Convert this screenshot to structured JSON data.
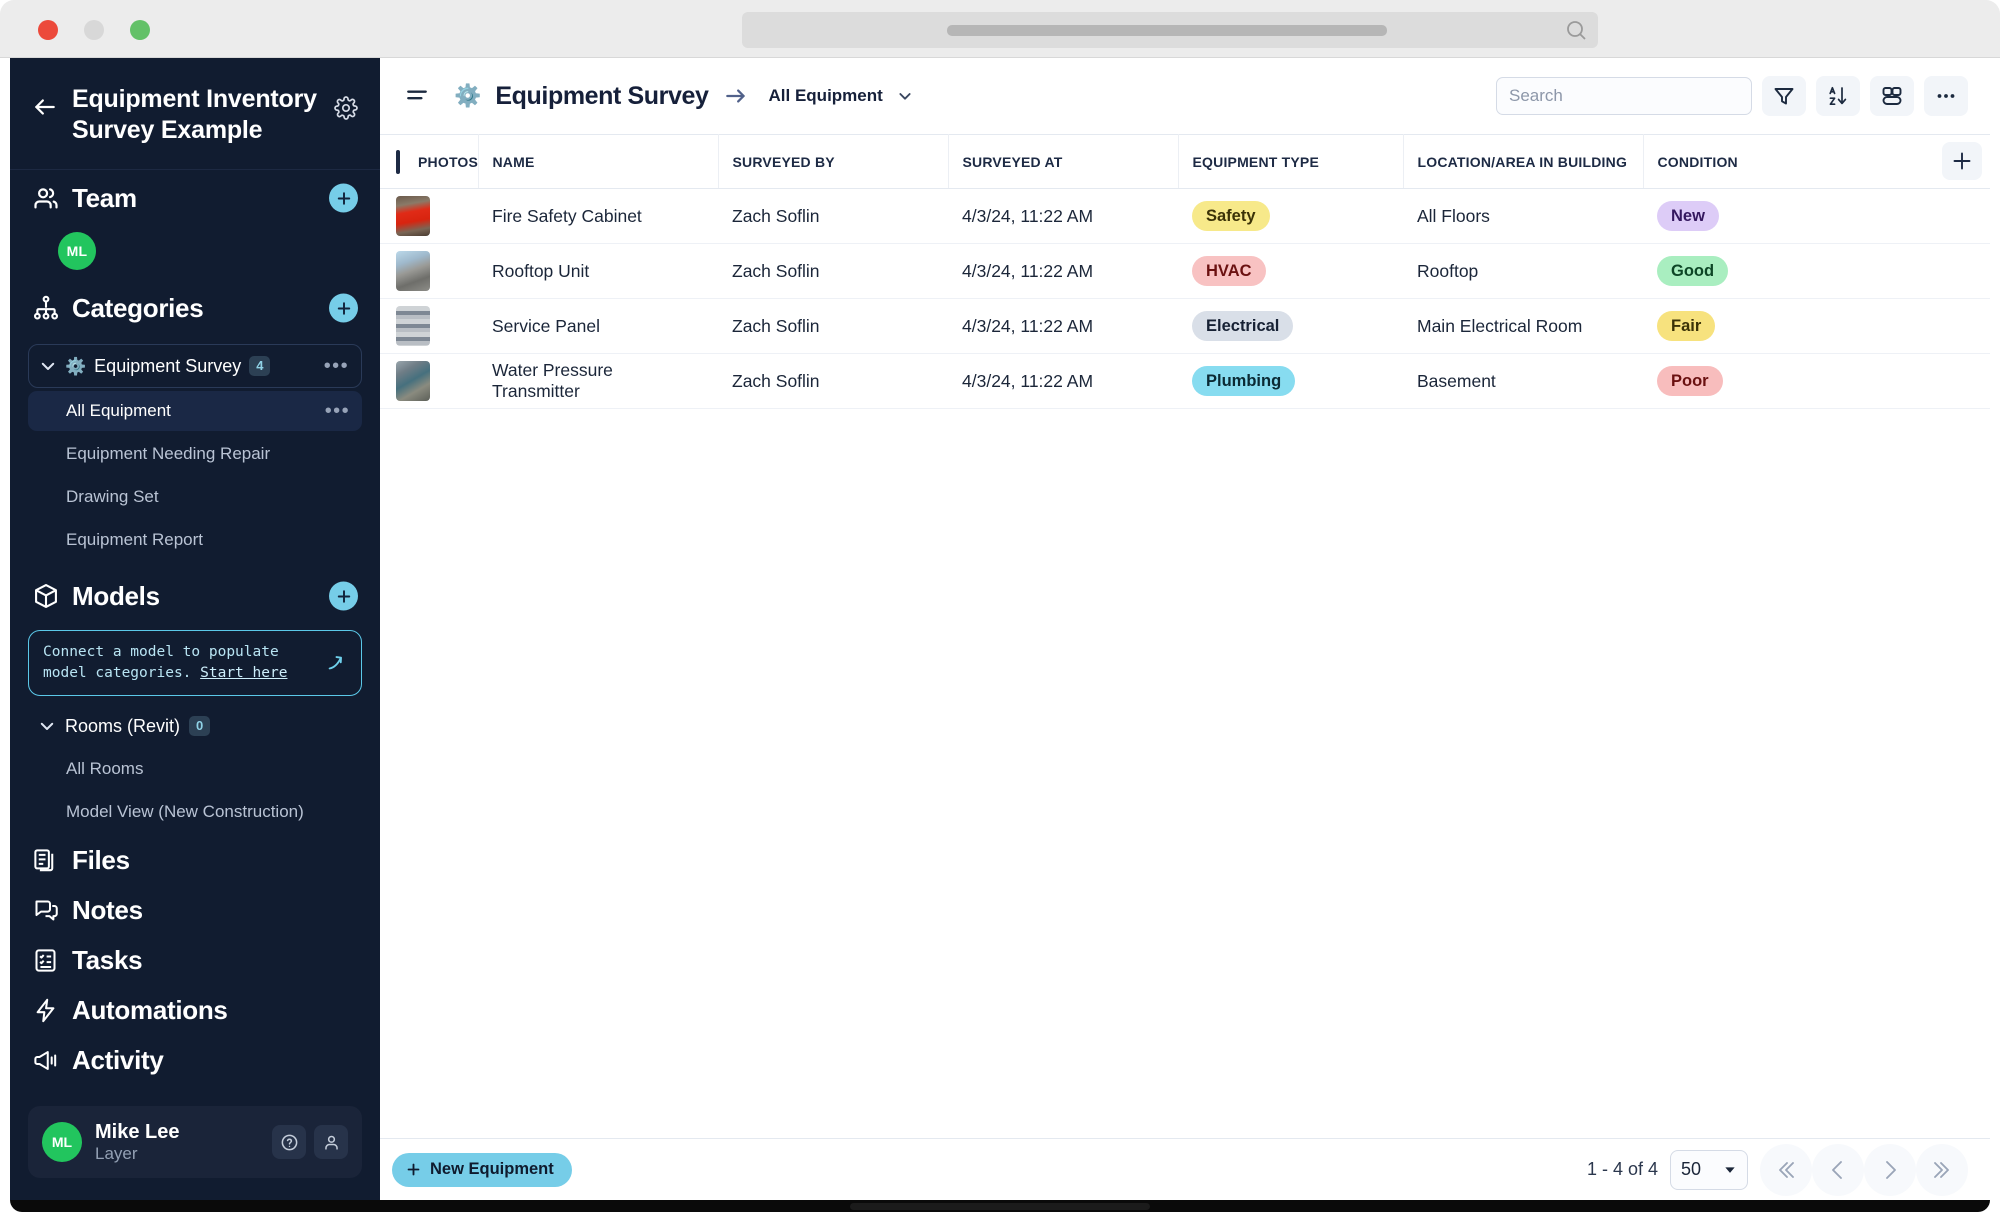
{
  "window": {
    "traffic_lights": [
      "close",
      "minimize",
      "zoom"
    ],
    "url_placeholder": ""
  },
  "sidebar": {
    "project_title": "Equipment Inventory Survey Example",
    "back_icon": "back-arrow-icon",
    "settings_icon": "gear-icon",
    "team": {
      "label": "Team",
      "icon": "people-icon",
      "add_label": "+",
      "members": [
        {
          "initials": "ML"
        }
      ]
    },
    "categories": {
      "label": "Categories",
      "icon": "hierarchy-icon",
      "add_label": "+",
      "groups": [
        {
          "emoji": "⚙️",
          "name": "Equipment Survey",
          "count": "4",
          "items": [
            {
              "label": "All Equipment",
              "active": true
            },
            {
              "label": "Equipment Needing Repair",
              "active": false
            },
            {
              "label": "Drawing Set",
              "active": false
            },
            {
              "label": "Equipment Report",
              "active": false
            }
          ]
        }
      ]
    },
    "models": {
      "label": "Models",
      "icon": "cube-icon",
      "add_label": "+",
      "banner": {
        "text": "Connect a model to populate model categories. ",
        "link": "Start here",
        "icon": "arrow-up-right-icon"
      },
      "groups": [
        {
          "name": "Rooms (Revit)",
          "count": "0",
          "items": [
            {
              "label": "All Rooms",
              "active": false
            },
            {
              "label": "Model View (New Construction)",
              "active": false
            }
          ]
        }
      ]
    },
    "nav": [
      {
        "label": "Files",
        "icon": "files-icon"
      },
      {
        "label": "Notes",
        "icon": "notes-icon"
      },
      {
        "label": "Tasks",
        "icon": "tasks-icon"
      },
      {
        "label": "Automations",
        "icon": "lightning-icon"
      },
      {
        "label": "Activity",
        "icon": "megaphone-icon"
      }
    ],
    "user": {
      "initials": "ML",
      "name": "Mike Lee",
      "org": "Layer",
      "help_icon": "question-circle-icon",
      "account_icon": "person-icon"
    }
  },
  "toolbar": {
    "menu_icon": "hamburger-icon",
    "breadcrumb_emoji": "⚙️",
    "breadcrumb_title": "Equipment Survey",
    "breadcrumb_arrow_icon": "arrow-right-icon",
    "breadcrumb_view": "All Equipment",
    "view_chevron_icon": "chevron-down-icon",
    "search_placeholder": "Search",
    "search_value": "",
    "filter_icon": "filter-icon",
    "sort_icon": "sort-az-icon",
    "group_icon": "group-icon",
    "more_icon": "more-horizontal-icon"
  },
  "table": {
    "select_all_checked": false,
    "add_column_icon": "plus-icon",
    "columns": [
      "PHOTOS",
      "NAME",
      "SURVEYED BY",
      "SURVEYED AT",
      "EQUIPMENT TYPE",
      "LOCATION/AREA IN BUILDING",
      "CONDITION"
    ],
    "rows": [
      {
        "photo_alt": "fire-safety-cabinet-photo",
        "name": "Fire Safety Cabinet",
        "surveyed_by": "Zach Soflin",
        "surveyed_at": "4/3/24, 11:22 AM",
        "equipment_type": "Safety",
        "equipment_type_bg": "#f7e98a",
        "equipment_type_fg": "#3b3207",
        "location": "All Floors",
        "condition": "New",
        "condition_bg": "#ddccf7",
        "condition_fg": "#35185f"
      },
      {
        "photo_alt": "rooftop-unit-photo",
        "name": "Rooftop Unit",
        "surveyed_by": "Zach Soflin",
        "surveyed_at": "4/3/24, 11:22 AM",
        "equipment_type": "HVAC",
        "equipment_type_bg": "#f8c2c2",
        "equipment_type_fg": "#6b1111",
        "location": "Rooftop",
        "condition": "Good",
        "condition_bg": "#a9eec0",
        "condition_fg": "#0d4626"
      },
      {
        "photo_alt": "service-panel-photo",
        "name": "Service Panel",
        "surveyed_by": "Zach Soflin",
        "surveyed_at": "4/3/24, 11:22 AM",
        "equipment_type": "Electrical",
        "equipment_type_bg": "#d9dfe8",
        "equipment_type_fg": "#172134",
        "location": "Main Electrical Room",
        "condition": "Fair",
        "condition_bg": "#f7e27e",
        "condition_fg": "#3b3207"
      },
      {
        "photo_alt": "water-pressure-transmitter-photo",
        "name": "Water Pressure Transmitter",
        "surveyed_by": "Zach Soflin",
        "surveyed_at": "4/3/24, 11:22 AM",
        "equipment_type": "Plumbing",
        "equipment_type_bg": "#87dcf0",
        "equipment_type_fg": "#0b2a34",
        "location": "Basement",
        "condition": "Poor",
        "condition_bg": "#f8bdbd",
        "condition_fg": "#6b1111"
      }
    ]
  },
  "footer": {
    "new_button": "New Equipment",
    "new_button_icon": "plus-icon",
    "range_text": "1 - 4 of 4",
    "page_size": "50",
    "page_size_chevron_icon": "chevron-down-icon",
    "first_page_icon": "chevrons-left-icon",
    "prev_page_icon": "chevron-left-icon",
    "next_page_icon": "chevron-right-icon",
    "last_page_icon": "chevrons-right-icon"
  },
  "colors": {
    "sidebar_bg": "#111c30",
    "accent_blue": "#76cde8",
    "avatar_green": "#22c55e",
    "banner_border": "#5bc8e8"
  }
}
